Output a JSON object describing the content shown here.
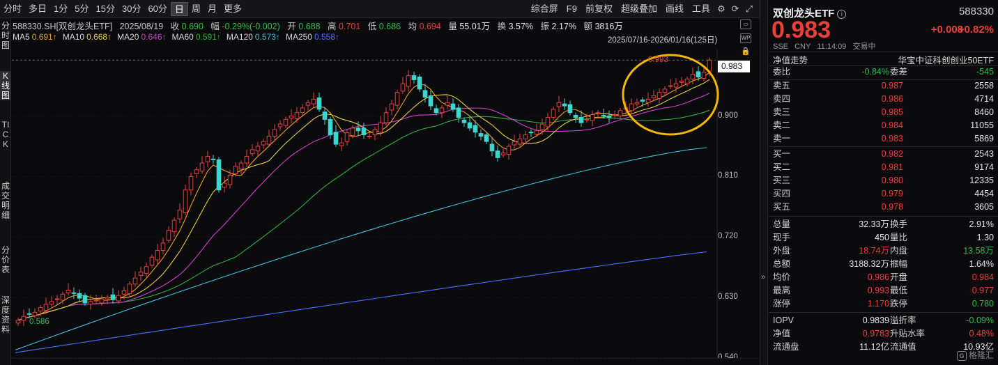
{
  "toolbar": {
    "periods": [
      "分时",
      "多日",
      "1分",
      "5分",
      "15分",
      "30分",
      "60分",
      "日",
      "周",
      "月",
      "更多"
    ],
    "active_period": "日",
    "tools": [
      "综合屏",
      "F9",
      "前复权",
      "超级叠加",
      "画线",
      "工具"
    ]
  },
  "left_tabs": [
    {
      "label": "分时图"
    },
    {
      "label": "K线图"
    },
    {
      "label": "TICK"
    },
    {
      "label": "成交明细"
    },
    {
      "label": "分价表"
    },
    {
      "label": "深度资料"
    }
  ],
  "kline_info": {
    "symbol": "588330.SH[双创龙头ETF]",
    "date": "2025/08/19",
    "close_label": "收",
    "close": "0.690",
    "amp_label": "幅",
    "amp": "-0.29%(-0.002)",
    "open_label": "开",
    "open": "0.688",
    "high_label": "高",
    "high": "0.701",
    "low_label": "低",
    "low": "0.686",
    "avg_label": "均",
    "avg": "0.694",
    "vol_label": "量",
    "vol": "55.01万",
    "turnover_label": "换",
    "turnover": "3.57%",
    "swing_label": "振",
    "swing": "2.17%",
    "amount_label": "额",
    "amount": "3816万"
  },
  "ma": [
    {
      "label": "MA5",
      "value": "0.691↑",
      "color": "#f0a020"
    },
    {
      "label": "MA10",
      "value": "0.668↑",
      "color": "#e8d040"
    },
    {
      "label": "MA20",
      "value": "0.646↑",
      "color": "#d040d0"
    },
    {
      "label": "MA60",
      "value": "0.591↑",
      "color": "#30b040"
    },
    {
      "label": "MA120",
      "value": "0.573↑",
      "color": "#40c0e0"
    },
    {
      "label": "MA250",
      "value": "0.558↑",
      "color": "#4a70ff"
    }
  ],
  "range_text": "2025/07/16-2026/01/16(125日)",
  "axis": {
    "ticks": [
      "0.900",
      "0.810",
      "0.720",
      "0.630",
      "0.540"
    ],
    "current_price": "0.983",
    "high_note": "0.993",
    "low_note": "0.586"
  },
  "chart_data": {
    "type": "candlestick",
    "ylim": [
      0.54,
      1.0
    ],
    "series_note": "daily OHLC, approximate",
    "closes": [
      0.596,
      0.602,
      0.605,
      0.608,
      0.615,
      0.62,
      0.624,
      0.628,
      0.635,
      0.641,
      0.636,
      0.629,
      0.622,
      0.624,
      0.626,
      0.628,
      0.63,
      0.627,
      0.633,
      0.64,
      0.65,
      0.659,
      0.668,
      0.676,
      0.69,
      0.7,
      0.711,
      0.73,
      0.745,
      0.76,
      0.79,
      0.81,
      0.82,
      0.83,
      0.84,
      0.835,
      0.79,
      0.8,
      0.812,
      0.825,
      0.83,
      0.84,
      0.85,
      0.855,
      0.862,
      0.87,
      0.88,
      0.888,
      0.895,
      0.9,
      0.905,
      0.912,
      0.92,
      0.925,
      0.91,
      0.895,
      0.872,
      0.858,
      0.86,
      0.875,
      0.882,
      0.878,
      0.872,
      0.87,
      0.88,
      0.89,
      0.905,
      0.918,
      0.935,
      0.948,
      0.96,
      0.954,
      0.94,
      0.928,
      0.915,
      0.905,
      0.912,
      0.92,
      0.91,
      0.898,
      0.89,
      0.882,
      0.876,
      0.87,
      0.862,
      0.848,
      0.838,
      0.845,
      0.855,
      0.862,
      0.866,
      0.872,
      0.875,
      0.878,
      0.888,
      0.898,
      0.91,
      0.92,
      0.915,
      0.905,
      0.898,
      0.89,
      0.895,
      0.902,
      0.905,
      0.9,
      0.898,
      0.902,
      0.908,
      0.912,
      0.918,
      0.92,
      0.922,
      0.925,
      0.93,
      0.935,
      0.94,
      0.945,
      0.948,
      0.952,
      0.955,
      0.962,
      0.958,
      0.965,
      0.983
    ]
  },
  "panel": {
    "name": "双创龙头ETF",
    "code": "588330",
    "price": "0.983",
    "change": "+0.008",
    "change_pct": "+0.82%",
    "sub": [
      "SSE",
      "CNY",
      "11:14:09",
      "交易中"
    ],
    "nav_label": "净值走势",
    "index_name": "华宝中证科创创业50ETF",
    "weibi_label": "委比",
    "weibi": "-0.84%",
    "weicha_label": "委差",
    "weicha": "-545",
    "asks": [
      {
        "label": "卖五",
        "price": "0.987",
        "vol": "2558"
      },
      {
        "label": "卖四",
        "price": "0.986",
        "vol": "4714"
      },
      {
        "label": "卖三",
        "price": "0.985",
        "vol": "8460"
      },
      {
        "label": "卖二",
        "price": "0.984",
        "vol": "11055"
      },
      {
        "label": "卖一",
        "price": "0.983",
        "vol": "5869"
      }
    ],
    "bids": [
      {
        "label": "买一",
        "price": "0.982",
        "vol": "2543"
      },
      {
        "label": "买二",
        "price": "0.981",
        "vol": "9174"
      },
      {
        "label": "买三",
        "price": "0.980",
        "vol": "12335"
      },
      {
        "label": "买四",
        "price": "0.979",
        "vol": "4454"
      },
      {
        "label": "买五",
        "price": "0.978",
        "vol": "3605"
      }
    ],
    "stats": [
      {
        "l1": "总量",
        "v1": "32.33万",
        "c1": "white",
        "l2": "换手",
        "v2": "2.91%",
        "c2": "white"
      },
      {
        "l1": "现手",
        "v1": "450",
        "c1": "white",
        "l2": "量比",
        "v2": "1.30",
        "c2": "white"
      },
      {
        "l1": "外盘",
        "v1": "18.74万",
        "c1": "red",
        "l2": "内盘",
        "v2": "13.58万",
        "c2": "green"
      },
      {
        "l1": "总额",
        "v1": "3188.32万",
        "c1": "white",
        "l2": "振幅",
        "v2": "1.64%",
        "c2": "white"
      },
      {
        "l1": "均价",
        "v1": "0.986",
        "c1": "red",
        "l2": "开盘",
        "v2": "0.984",
        "c2": "red"
      },
      {
        "l1": "最高",
        "v1": "0.993",
        "c1": "red",
        "l2": "最低",
        "v2": "0.977",
        "c2": "red"
      },
      {
        "l1": "涨停",
        "v1": "1.170",
        "c1": "red",
        "l2": "跌停",
        "v2": "0.780",
        "c2": "green"
      },
      {
        "l1": "IOPV",
        "v1": "0.9839",
        "c1": "white",
        "l2": "溢折率",
        "v2": "-0.09%",
        "c2": "green"
      },
      {
        "l1": "净值",
        "v1": "0.9783",
        "c1": "red",
        "l2": "升贴水率",
        "v2": "0.48%",
        "c2": "red"
      },
      {
        "l1": "流通盘",
        "v1": "11.12亿",
        "c1": "white",
        "l2": "流通值",
        "v2": "10.93亿",
        "c2": "white"
      }
    ],
    "watermark": "格隆汇"
  },
  "colors": {
    "up": "#e8403a",
    "down": "#3dd6d0",
    "highlight_ring": "#f5b800"
  }
}
